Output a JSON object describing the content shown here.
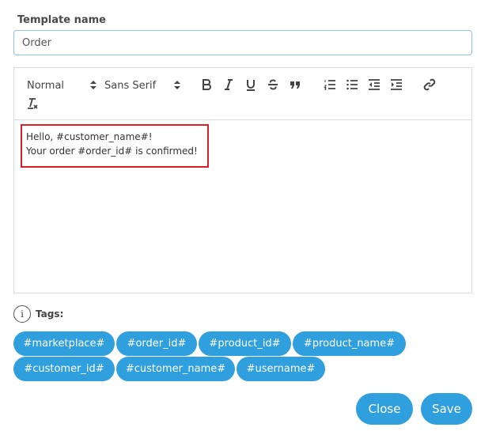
{
  "form": {
    "name_label": "Template name",
    "name_value": "Order"
  },
  "toolbar": {
    "header_select": "Normal",
    "font_select": "Sans Serif",
    "icons": [
      "bold-icon",
      "italic-icon",
      "underline-icon",
      "strike-icon",
      "blockquote-icon",
      "ordered-list-icon",
      "bullet-list-icon",
      "outdent-icon",
      "indent-icon",
      "link-icon",
      "clear-format-icon"
    ]
  },
  "editor": {
    "lines": [
      "Hello, #customer_name#!",
      "Your order #order_id# is confirmed!"
    ]
  },
  "tags": {
    "info_glyph": "i",
    "label": "Tags:",
    "items": [
      "#marketplace#",
      "#order_id#",
      "#product_id#",
      "#product_name#",
      "#customer_id#",
      "#customer_name#",
      "#username#"
    ]
  },
  "actions": {
    "close_label": "Close",
    "save_label": "Save"
  },
  "colors": {
    "accent": "#2f9fdd",
    "highlight": "#d9202a",
    "input_border": "#8fc3e3"
  }
}
